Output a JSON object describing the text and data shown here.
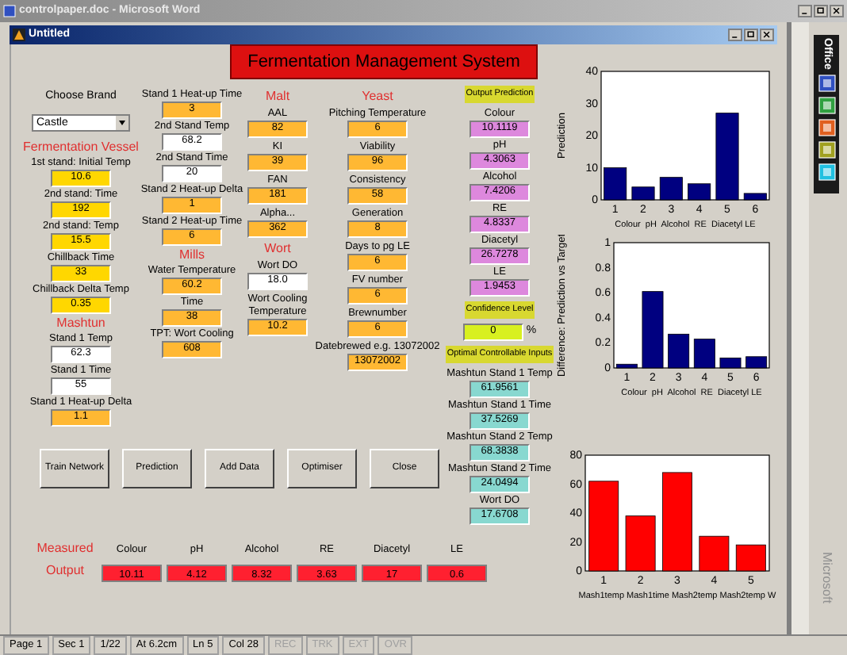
{
  "word_window": {
    "title": "controlpaper.doc - Microsoft Word"
  },
  "figure_window": {
    "title": "Untitled"
  },
  "banner": "Fermentation Management System",
  "columns": [
    [
      {
        "kind": "text",
        "label": "Choose Brand"
      },
      {
        "kind": "select",
        "value": "Castle"
      },
      {
        "kind": "heading",
        "label": "Fermentation Vessel"
      },
      {
        "kind": "field",
        "label": "1st stand: Initial Temp",
        "value": "10.6",
        "color": "#ffd700"
      },
      {
        "kind": "field",
        "label": "2nd stand: Time",
        "value": "192",
        "color": "#ffd700"
      },
      {
        "kind": "field",
        "label": "2nd stand: Temp",
        "value": "15.5",
        "color": "#ffd700"
      },
      {
        "kind": "field",
        "label": "Chillback Time",
        "value": "33",
        "color": "#ffd700"
      },
      {
        "kind": "field",
        "label": "Chillback Delta Temp",
        "value": "0.35",
        "color": "#ffd700"
      },
      {
        "kind": "heading",
        "label": "Mashtun"
      },
      {
        "kind": "field",
        "label": "Stand 1 Temp",
        "value": "62.3",
        "color": "#ffffff"
      },
      {
        "kind": "field",
        "label": "Stand 1 Time",
        "value": "55",
        "color": "#ffffff"
      },
      {
        "kind": "field",
        "label": "Stand 1 Heat-up Delta",
        "value": "1.1",
        "color": "#ffb833"
      }
    ],
    [
      {
        "kind": "field",
        "label": "Stand 1 Heat-up Time",
        "value": "3",
        "color": "#ffb833"
      },
      {
        "kind": "field",
        "label": "2nd Stand Temp",
        "value": "68.2",
        "color": "#ffffff"
      },
      {
        "kind": "field",
        "label": "2nd Stand Time",
        "value": "20",
        "color": "#ffffff"
      },
      {
        "kind": "field",
        "label": "Stand 2 Heat-up Delta",
        "value": "1",
        "color": "#ffb833"
      },
      {
        "kind": "field",
        "label": "Stand 2 Heat-up Time",
        "value": "6",
        "color": "#ffb833"
      },
      {
        "kind": "heading",
        "label": "Mills"
      },
      {
        "kind": "field",
        "label": "Water Temperature",
        "value": "60.2",
        "color": "#ffb833"
      },
      {
        "kind": "field",
        "label": "Time",
        "value": "38",
        "color": "#ffb833"
      },
      {
        "kind": "field",
        "label": "TPT: Wort Cooling",
        "value": "608",
        "color": "#ffb833"
      }
    ],
    [
      {
        "kind": "heading",
        "label": "Malt"
      },
      {
        "kind": "field",
        "label": "AAL",
        "value": "82",
        "color": "#ffb833"
      },
      {
        "kind": "field",
        "label": "KI",
        "value": "39",
        "color": "#ffb833"
      },
      {
        "kind": "field",
        "label": "FAN",
        "value": "181",
        "color": "#ffb833"
      },
      {
        "kind": "field",
        "label": "Alpha...",
        "value": "362",
        "color": "#ffb833"
      },
      {
        "kind": "heading",
        "label": "Wort"
      },
      {
        "kind": "field",
        "label": "Wort DO",
        "value": "18.0",
        "color": "#ffffff"
      },
      {
        "kind": "field",
        "label": "Wort Cooling Temperature",
        "value": "10.2",
        "color": "#ffb833"
      }
    ],
    [
      {
        "kind": "heading",
        "label": "Yeast"
      },
      {
        "kind": "field",
        "label": "Pitching Temperature",
        "value": "6",
        "color": "#ffb833"
      },
      {
        "kind": "field",
        "label": "Viability",
        "value": "96",
        "color": "#ffb833"
      },
      {
        "kind": "field",
        "label": "Consistency",
        "value": "58",
        "color": "#ffb833"
      },
      {
        "kind": "field",
        "label": "Generation",
        "value": "8",
        "color": "#ffb833"
      },
      {
        "kind": "field",
        "label": "Days to pg LE",
        "value": "6",
        "color": "#ffb833"
      },
      {
        "kind": "field",
        "label": "FV number",
        "value": "6",
        "color": "#ffb833"
      },
      {
        "kind": "field",
        "label": "Brewnumber",
        "value": "6",
        "color": "#ffb833"
      },
      {
        "kind": "field",
        "label": "Datebrewed e.g. 13072002",
        "value": "13072002",
        "color": "#ffb833"
      }
    ],
    [
      {
        "kind": "tag",
        "label": "Output Prediction"
      },
      {
        "kind": "field",
        "label": "Colour",
        "value": "10.1119",
        "color": "#dd88dd"
      },
      {
        "kind": "field",
        "label": "pH",
        "value": "4.3063",
        "color": "#dd88dd"
      },
      {
        "kind": "field",
        "label": "Alcohol",
        "value": "7.4206",
        "color": "#dd88dd"
      },
      {
        "kind": "field",
        "label": "RE",
        "value": "4.8337",
        "color": "#dd88dd"
      },
      {
        "kind": "field",
        "label": "Diacetyl",
        "value": "26.7278",
        "color": "#dd88dd"
      },
      {
        "kind": "field",
        "label": "LE",
        "value": "1.9453",
        "color": "#dd88dd"
      },
      {
        "kind": "tag",
        "label": "Confidence Level"
      },
      {
        "kind": "field",
        "value": "0",
        "unit": "%",
        "color": "#d8f020"
      },
      {
        "kind": "tag",
        "label": "Optimal Controllable Inputs"
      },
      {
        "kind": "field",
        "label": "Mashtun Stand 1 Temp",
        "value": "61.9561",
        "color": "#88d8d0"
      },
      {
        "kind": "field",
        "label": "Mashtun Stand 1 Time",
        "value": "37.5269",
        "color": "#88d8d0"
      },
      {
        "kind": "field",
        "label": "Mashtun Stand 2 Temp",
        "value": "68.3838",
        "color": "#88d8d0"
      },
      {
        "kind": "field",
        "label": "Mashtun Stand 2 Time",
        "value": "24.0494",
        "color": "#88d8d0"
      },
      {
        "kind": "field",
        "label": "Wort DO",
        "value": "17.6708",
        "color": "#88d8d0"
      }
    ]
  ],
  "buttons": [
    "Train Network",
    "Prediction",
    "Add Data",
    "Optimiser",
    "Close"
  ],
  "measured": {
    "title": [
      "Measured",
      "Output"
    ],
    "items": [
      {
        "label": "Colour",
        "value": "10.11"
      },
      {
        "label": "pH",
        "value": "4.12"
      },
      {
        "label": "Alcohol",
        "value": "8.32"
      },
      {
        "label": "RE",
        "value": "3.63"
      },
      {
        "label": "Diacetyl",
        "value": "17"
      },
      {
        "label": "LE",
        "value": "0.6"
      }
    ]
  },
  "charts": [
    {
      "chart_data": {
        "type": "bar",
        "ylabel": "Prediction",
        "xlabel": "Colour  pH  Alcohol  RE  Diacetyl LE",
        "categories": [
          "1",
          "2",
          "3",
          "4",
          "5",
          "6"
        ],
        "series": [
          {
            "color": "#000080",
            "values": [
              10,
              4,
              7,
              5,
              27,
              2
            ]
          }
        ],
        "ylim": [
          0,
          40
        ],
        "yticks": [
          0,
          10,
          20,
          30,
          40
        ]
      }
    },
    {
      "chart_data": {
        "type": "bar",
        "ylabel": "Difference: Prediction vs Target",
        "xlabel": "Colour  pH  Alcohol  RE  Diacetyl LE",
        "categories": [
          "1",
          "2",
          "3",
          "4",
          "5",
          "6"
        ],
        "series": [
          {
            "color": "#000080",
            "values": [
              0.03,
              0.61,
              0.27,
              0.23,
              0.08,
              0.09
            ]
          }
        ],
        "ylim": [
          0,
          1
        ],
        "yticks": [
          0,
          0.2,
          0.4,
          0.6,
          0.8,
          1
        ]
      }
    },
    {
      "chart_data": {
        "type": "bar",
        "xlabel": "Mash1temp Mash1time Mash2temp Mash2temp W",
        "categories": [
          "1",
          "2",
          "3",
          "4",
          "5"
        ],
        "series": [
          {
            "color": "#ff0000",
            "values": [
              62,
              38,
              68,
              24,
              18
            ]
          }
        ],
        "ylim": [
          0,
          80
        ],
        "yticks": [
          0,
          20,
          40,
          60,
          80
        ]
      }
    }
  ],
  "office_bar": {
    "title": "Office"
  },
  "side_label": "Microsoft",
  "status_bar": [
    {
      "label": "Page 1",
      "enabled": true
    },
    {
      "label": "Sec 1",
      "enabled": true
    },
    {
      "label": "1/22",
      "enabled": true
    },
    {
      "label": "At 6.2cm",
      "enabled": true
    },
    {
      "label": "Ln 5",
      "enabled": true
    },
    {
      "label": "Col 28",
      "enabled": true
    },
    {
      "label": "REC",
      "enabled": false
    },
    {
      "label": "TRK",
      "enabled": false
    },
    {
      "label": "EXT",
      "enabled": false
    },
    {
      "label": "OVR",
      "enabled": false
    }
  ]
}
